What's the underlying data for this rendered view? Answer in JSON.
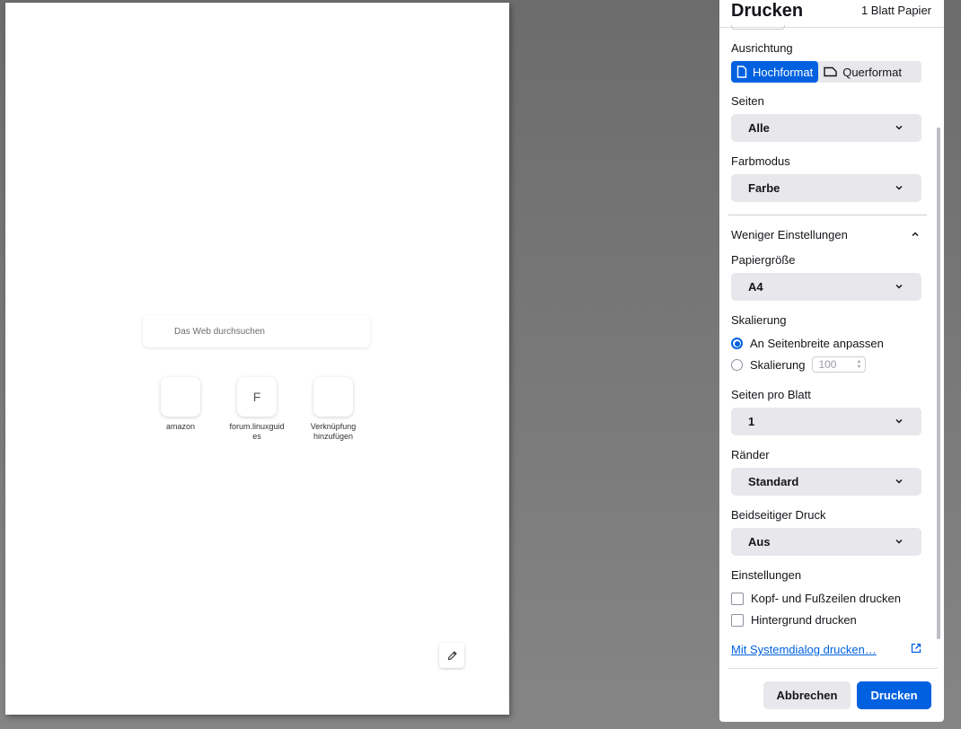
{
  "preview": {
    "search_placeholder": "Das Web durchsuchen",
    "tiles": [
      {
        "letter": "",
        "label": "amazon"
      },
      {
        "letter": "F",
        "label": "forum.linuxguides"
      },
      {
        "letter": "",
        "label": "Verknüpfung hinzufügen"
      }
    ]
  },
  "panel": {
    "title": "Drucken",
    "sheets": "1 Blatt Papier",
    "orientation": {
      "label": "Ausrichtung",
      "portrait": "Hochformat",
      "landscape": "Querformat"
    },
    "pages": {
      "label": "Seiten",
      "value": "Alle"
    },
    "color_mode": {
      "label": "Farbmodus",
      "value": "Farbe"
    },
    "less_settings": "Weniger Einstellungen",
    "paper_size": {
      "label": "Papiergröße",
      "value": "A4"
    },
    "scaling": {
      "label": "Skalierung",
      "fit_width": "An Seitenbreite anpassen",
      "custom": "Skalierung",
      "custom_value": "100"
    },
    "pages_per_sheet": {
      "label": "Seiten pro Blatt",
      "value": "1"
    },
    "margins": {
      "label": "Ränder",
      "value": "Standard"
    },
    "duplex": {
      "label": "Beidseitiger Druck",
      "value": "Aus"
    },
    "settings": {
      "label": "Einstellungen",
      "headers_footers": "Kopf- und Fußzeilen drucken",
      "background": "Hintergrund drucken"
    },
    "system_dialog": "Mit Systemdialog drucken…",
    "cancel": "Abbrechen",
    "print": "Drucken"
  },
  "colors": {
    "accent": "#0061e0",
    "select_bg": "#e8e8ec"
  }
}
